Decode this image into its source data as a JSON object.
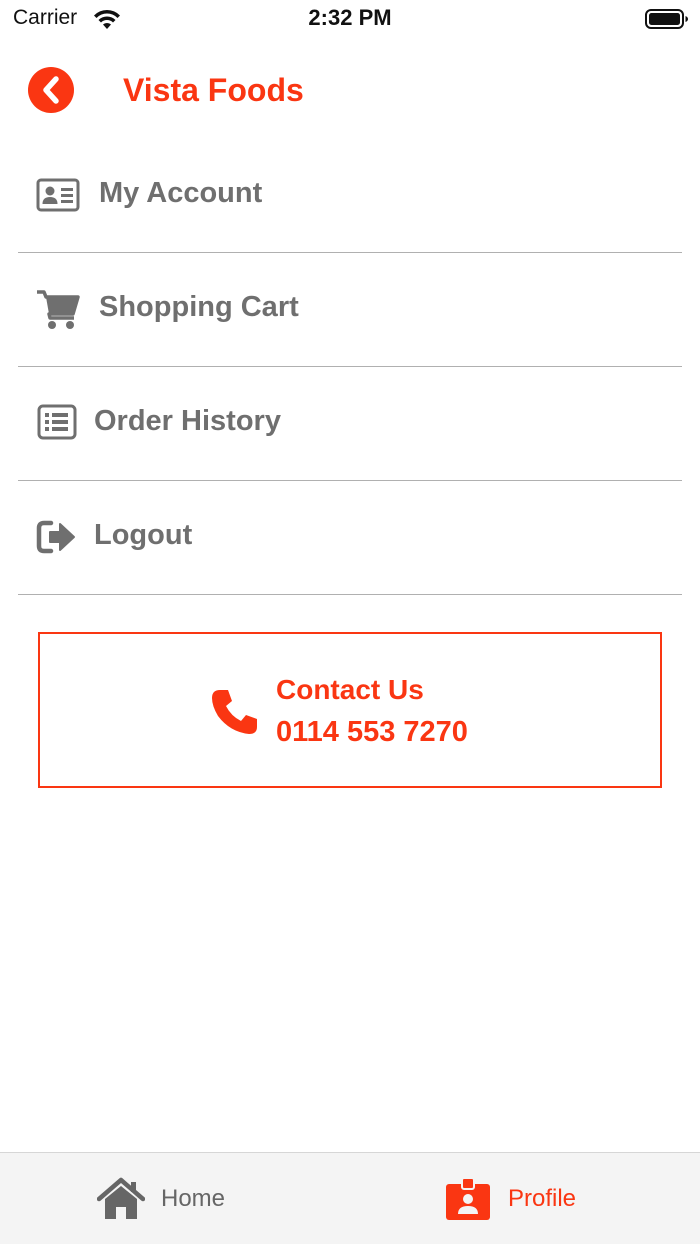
{
  "status_bar": {
    "carrier": "Carrier",
    "time": "2:32 PM"
  },
  "header": {
    "title": "Vista Foods",
    "back_icon": "chevron-left-circle-icon"
  },
  "menu": {
    "items": [
      {
        "label": "My Account",
        "icon": "id-card-icon"
      },
      {
        "label": "Shopping Cart",
        "icon": "cart-icon"
      },
      {
        "label": "Order History",
        "icon": "list-icon"
      },
      {
        "label": "Logout",
        "icon": "logout-icon"
      }
    ]
  },
  "contact": {
    "title": "Contact Us",
    "phone": "0114 553 7270",
    "icon": "phone-icon"
  },
  "tabs": [
    {
      "label": "Home",
      "icon": "home-icon",
      "active": false
    },
    {
      "label": "Profile",
      "icon": "profile-badge-icon",
      "active": true
    }
  ],
  "colors": {
    "accent": "#fa3612",
    "menu_text": "#6f6f6f",
    "inactive_tab": "#666666",
    "divider": "#b0b0b0"
  }
}
